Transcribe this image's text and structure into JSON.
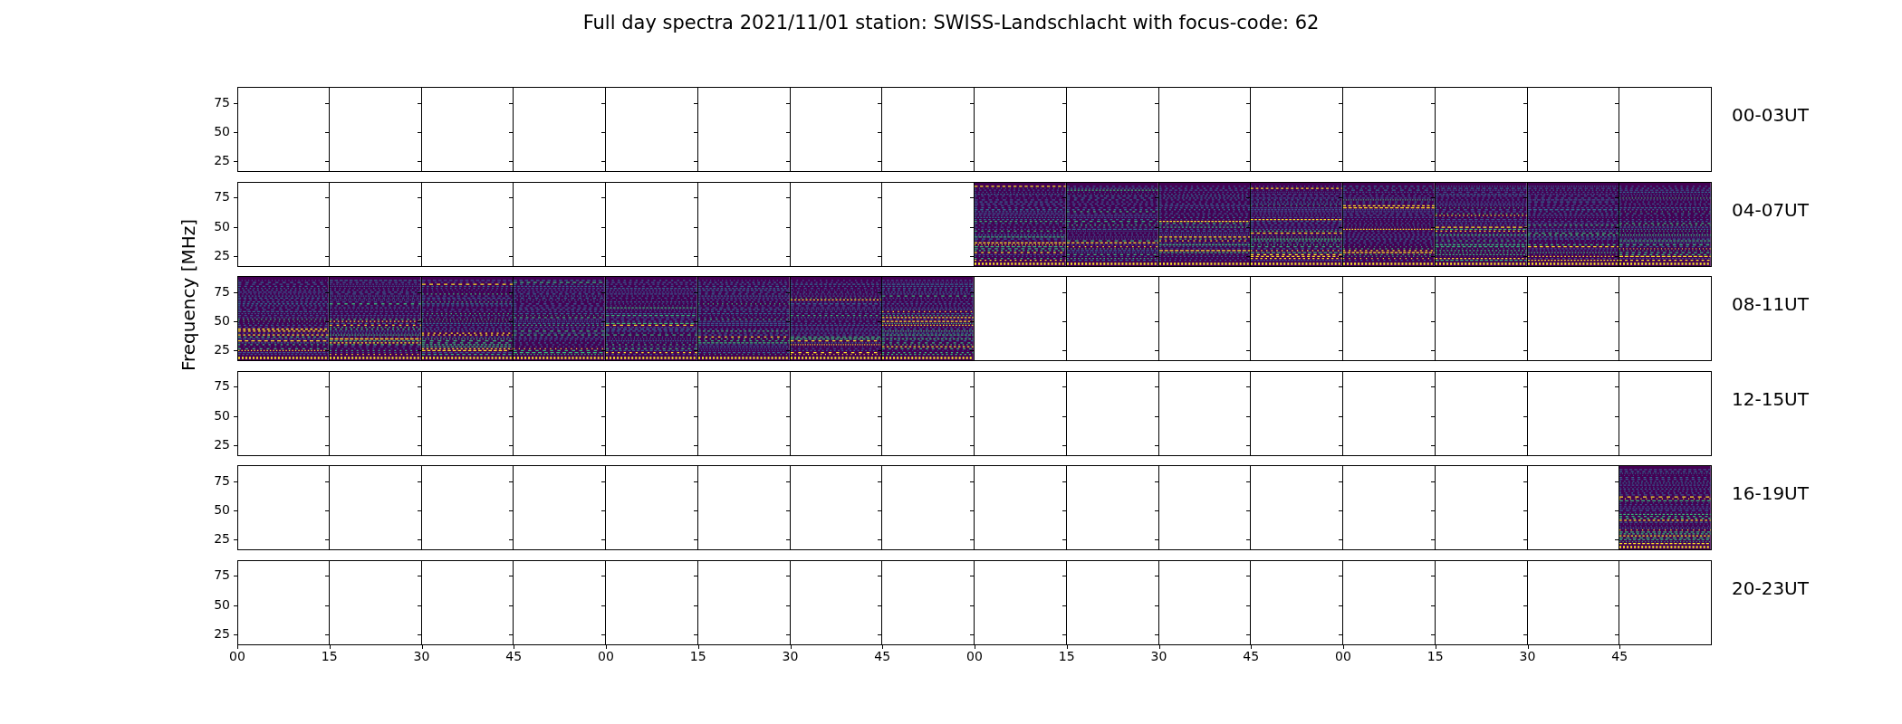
{
  "title": "Full day spectra 2021/11/01 station: SWISS-Landschlacht with focus-code: 62",
  "ylabel": "Frequency [MHz]",
  "rows": [
    {
      "label": "00-03UT",
      "yticks": [
        "75",
        "50",
        "25"
      ],
      "panels": [
        {
          "has_data": false
        },
        {
          "has_data": false
        },
        {
          "has_data": false
        },
        {
          "has_data": false
        },
        {
          "has_data": false
        },
        {
          "has_data": false
        },
        {
          "has_data": false
        },
        {
          "has_data": false
        },
        {
          "has_data": false
        },
        {
          "has_data": false
        },
        {
          "has_data": false
        },
        {
          "has_data": false
        },
        {
          "has_data": false
        },
        {
          "has_data": false
        },
        {
          "has_data": false
        },
        {
          "has_data": false
        }
      ]
    },
    {
      "label": "04-07UT",
      "yticks": [
        "75",
        "50",
        "25"
      ],
      "panels": [
        {
          "has_data": false
        },
        {
          "has_data": false
        },
        {
          "has_data": false
        },
        {
          "has_data": false
        },
        {
          "has_data": false
        },
        {
          "has_data": false
        },
        {
          "has_data": false
        },
        {
          "has_data": false
        },
        {
          "has_data": true
        },
        {
          "has_data": true
        },
        {
          "has_data": true
        },
        {
          "has_data": true
        },
        {
          "has_data": true
        },
        {
          "has_data": true
        },
        {
          "has_data": true
        },
        {
          "has_data": true
        }
      ]
    },
    {
      "label": "08-11UT",
      "yticks": [
        "75",
        "50",
        "25"
      ],
      "panels": [
        {
          "has_data": true
        },
        {
          "has_data": true
        },
        {
          "has_data": true
        },
        {
          "has_data": true
        },
        {
          "has_data": true
        },
        {
          "has_data": true
        },
        {
          "has_data": true
        },
        {
          "has_data": true
        },
        {
          "has_data": false
        },
        {
          "has_data": false
        },
        {
          "has_data": false
        },
        {
          "has_data": false
        },
        {
          "has_data": false
        },
        {
          "has_data": false
        },
        {
          "has_data": false
        },
        {
          "has_data": false
        }
      ]
    },
    {
      "label": "12-15UT",
      "yticks": [
        "75",
        "50",
        "25"
      ],
      "panels": [
        {
          "has_data": false
        },
        {
          "has_data": false
        },
        {
          "has_data": false
        },
        {
          "has_data": false
        },
        {
          "has_data": false
        },
        {
          "has_data": false
        },
        {
          "has_data": false
        },
        {
          "has_data": false
        },
        {
          "has_data": false
        },
        {
          "has_data": false
        },
        {
          "has_data": false
        },
        {
          "has_data": false
        },
        {
          "has_data": false
        },
        {
          "has_data": false
        },
        {
          "has_data": false
        },
        {
          "has_data": false
        }
      ]
    },
    {
      "label": "16-19UT",
      "yticks": [
        "75",
        "50",
        "25"
      ],
      "panels": [
        {
          "has_data": false
        },
        {
          "has_data": false
        },
        {
          "has_data": false
        },
        {
          "has_data": false
        },
        {
          "has_data": false
        },
        {
          "has_data": false
        },
        {
          "has_data": false
        },
        {
          "has_data": false
        },
        {
          "has_data": false
        },
        {
          "has_data": false
        },
        {
          "has_data": false
        },
        {
          "has_data": false
        },
        {
          "has_data": false
        },
        {
          "has_data": false
        },
        {
          "has_data": false
        },
        {
          "has_data": true
        }
      ]
    },
    {
      "label": "20-23UT",
      "yticks": [
        "75",
        "50",
        "25"
      ],
      "panels": [
        {
          "has_data": false
        },
        {
          "has_data": false
        },
        {
          "has_data": false
        },
        {
          "has_data": false
        },
        {
          "has_data": false
        },
        {
          "has_data": false
        },
        {
          "has_data": false
        },
        {
          "has_data": false
        },
        {
          "has_data": false
        },
        {
          "has_data": false
        },
        {
          "has_data": false
        },
        {
          "has_data": false
        },
        {
          "has_data": false
        },
        {
          "has_data": false
        },
        {
          "has_data": false
        },
        {
          "has_data": false
        }
      ]
    }
  ],
  "xticks": [
    "00",
    "15",
    "30",
    "45",
    "00",
    "15",
    "30",
    "45",
    "00",
    "15",
    "30",
    "45",
    "00",
    "15",
    "30",
    "45"
  ]
}
